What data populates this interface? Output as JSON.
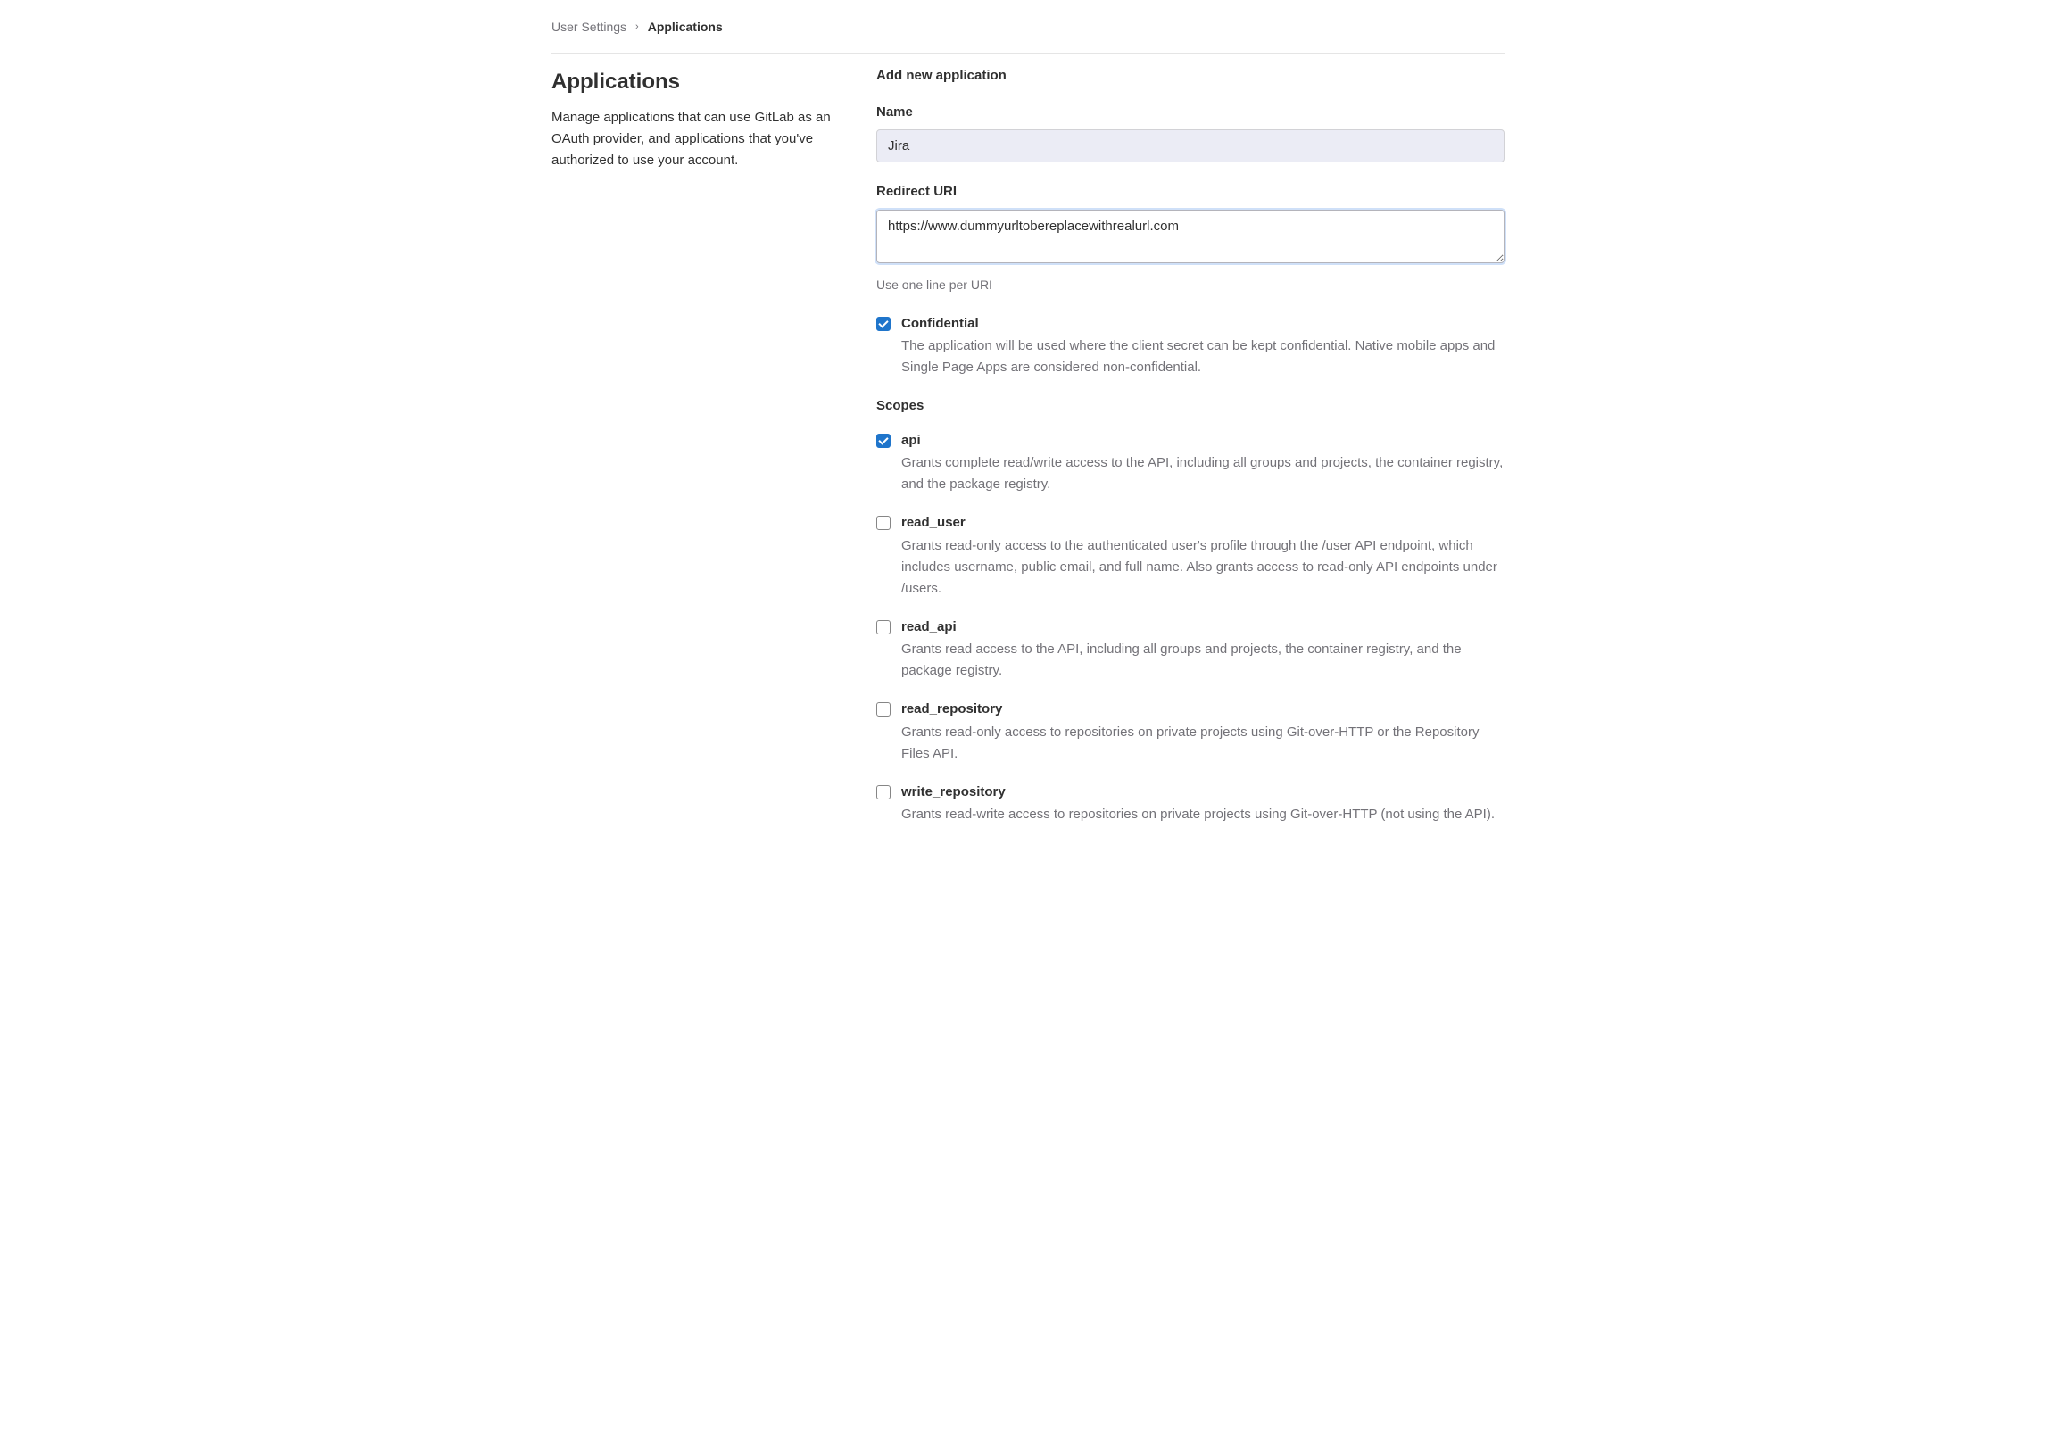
{
  "breadcrumb": {
    "parent": "User Settings",
    "current": "Applications"
  },
  "sidebar": {
    "title": "Applications",
    "description": "Manage applications that can use GitLab as an OAuth provider, and applications that you've authorized to use your account."
  },
  "form": {
    "heading": "Add new application",
    "name_label": "Name",
    "name_value": "Jira",
    "redirect_label": "Redirect URI",
    "redirect_value": "https://www.dummyurltobereplacewithrealurl.com",
    "redirect_help": "Use one line per URI",
    "confidential": {
      "label": "Confidential",
      "description": "The application will be used where the client secret can be kept confidential. Native mobile apps and Single Page Apps are considered non-confidential.",
      "checked": true
    },
    "scopes_heading": "Scopes",
    "scopes": [
      {
        "name": "api",
        "description": "Grants complete read/write access to the API, including all groups and projects, the container registry, and the package registry.",
        "checked": true
      },
      {
        "name": "read_user",
        "description": "Grants read-only access to the authenticated user's profile through the /user API endpoint, which includes username, public email, and full name. Also grants access to read-only API endpoints under /users.",
        "checked": false
      },
      {
        "name": "read_api",
        "description": "Grants read access to the API, including all groups and projects, the container registry, and the package registry.",
        "checked": false
      },
      {
        "name": "read_repository",
        "description": "Grants read-only access to repositories on private projects using Git-over-HTTP or the Repository Files API.",
        "checked": false
      },
      {
        "name": "write_repository",
        "description": "Grants read-write access to repositories on private projects using Git-over-HTTP (not using the API).",
        "checked": false
      }
    ]
  }
}
